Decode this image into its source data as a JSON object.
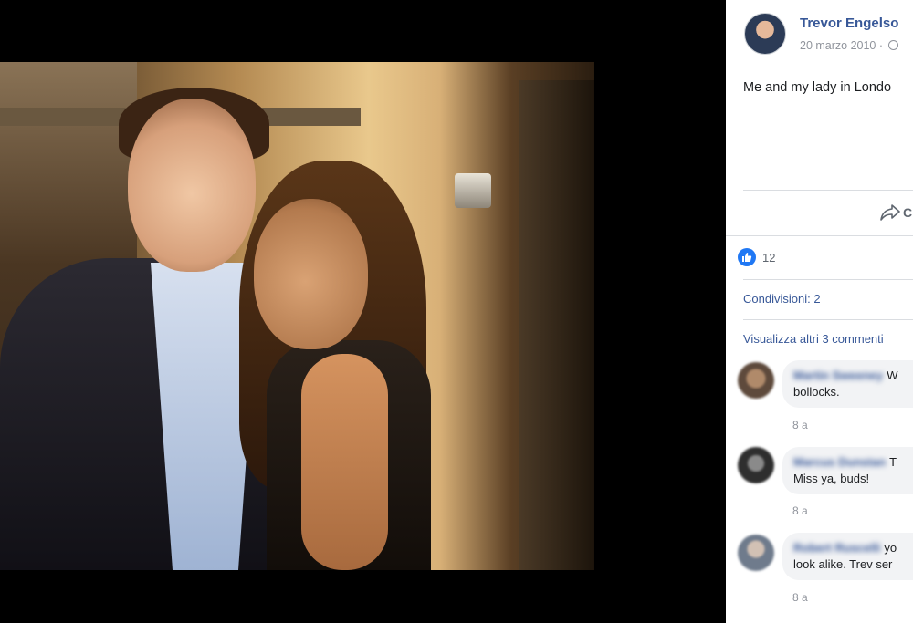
{
  "photo": {
    "description_icon": "photo-of-couple"
  },
  "post": {
    "author": "Trevor Engelso",
    "date": "20 marzo 2010 ·",
    "caption": "Me and my lady in Londo",
    "share_label": "C",
    "like_count": "12",
    "shares": "Condivisioni: 2",
    "more_comments": "Visualizza altri 3 commenti"
  },
  "comments": [
    {
      "name": "Martin Sweeney",
      "first_text": "W",
      "second_text": "bollocks.",
      "time": "8 a"
    },
    {
      "name": "Marcus Dunstan",
      "first_text": "T",
      "second_text": "Miss ya, buds!",
      "time": "8 a"
    },
    {
      "name": "Robert Ruscelli",
      "first_text": "yo",
      "second_text": "look alike. Trev ser",
      "time": "8 a"
    }
  ],
  "colors": {
    "link": "#385898",
    "like_blue": "#2078f4",
    "bubble": "#f2f3f5"
  }
}
